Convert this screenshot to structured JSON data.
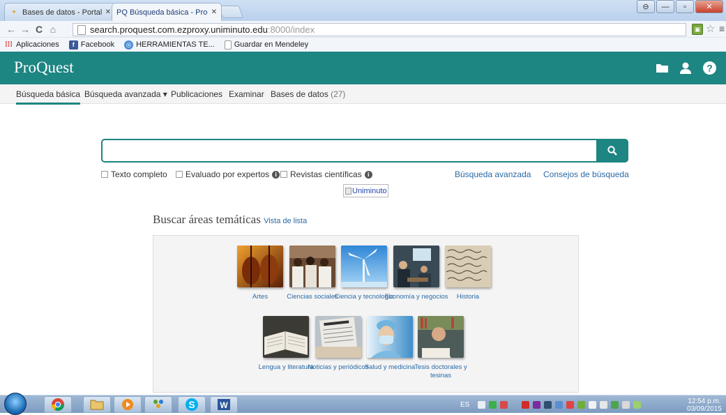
{
  "browser": {
    "tabs": [
      {
        "label": "Bases de datos - Portal UI",
        "favicon": "bookmark-star-icon"
      },
      {
        "label": "PQ Búsqueda básica - ProQue",
        "favicon": "pq-icon"
      }
    ],
    "url_host": "search.proquest.com.ezproxy.uniminuto.edu",
    "url_path": ":8000/index",
    "bookmarks": [
      {
        "label": "Aplicaciones"
      },
      {
        "label": "Facebook"
      },
      {
        "label": "HERRAMIENTAS TE..."
      },
      {
        "label": "Guardar en Mendeley"
      }
    ]
  },
  "header": {
    "logo": "ProQuest",
    "color": "#1d8582",
    "icons": [
      "folder-icon",
      "user-icon",
      "help-icon"
    ]
  },
  "subnav": {
    "basic": "Búsqueda básica",
    "advanced": "Búsqueda avanzada",
    "caret": "▾",
    "publications": "Publicaciones",
    "browse": "Examinar",
    "databases": "Bases de datos",
    "databases_count": "(27)"
  },
  "search": {
    "value": "",
    "full_text": "Texto completo",
    "peer_reviewed": "Evaluado por expertos",
    "scholarly": "Revistas científicas",
    "advanced_link": "Búsqueda avanzada",
    "tips_link": "Consejos de búsqueda",
    "image_alt": "Uniminuto"
  },
  "areas": {
    "title": "Buscar áreas temáticas",
    "list_view": "Vista de lista",
    "items": [
      {
        "label": "Artes"
      },
      {
        "label": "Ciencias sociales"
      },
      {
        "label": "Ciencia y tecnología"
      },
      {
        "label": "Economía y negocios"
      },
      {
        "label": "Historia"
      },
      {
        "label": "Lengua y literatura"
      },
      {
        "label": "Noticias y periódicos"
      },
      {
        "label": "Salud y medicina"
      },
      {
        "label": "Tesis doctorales y tesinas"
      }
    ]
  },
  "taskbar": {
    "lang": "ES",
    "time": "12:54 p.m.",
    "date": "03/09/2015"
  }
}
